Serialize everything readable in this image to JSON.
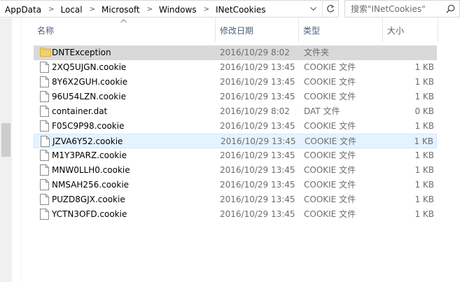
{
  "address_bar": {
    "crumbs": [
      "AppData",
      "Local",
      "Microsoft",
      "Windows",
      "INetCookies"
    ],
    "separator": ">"
  },
  "search": {
    "placeholder": "搜索\"INetCookies\""
  },
  "columns": {
    "name": "名称",
    "date": "修改日期",
    "type": "类型",
    "size": "大小"
  },
  "files": [
    {
      "name": "DNTException",
      "date": "2016/10/29 8:02",
      "type": "文件夹",
      "size": "",
      "icon": "folder-icon",
      "state": "selected"
    },
    {
      "name": "2XQ5UJGN.cookie",
      "date": "2016/10/29 13:45",
      "type": "COOKIE 文件",
      "size": "1 KB",
      "icon": "file-icon",
      "state": ""
    },
    {
      "name": "8Y6X2GUH.cookie",
      "date": "2016/10/29 13:45",
      "type": "COOKIE 文件",
      "size": "1 KB",
      "icon": "file-icon",
      "state": ""
    },
    {
      "name": "96U54LZN.cookie",
      "date": "2016/10/29 13:45",
      "type": "COOKIE 文件",
      "size": "1 KB",
      "icon": "file-icon",
      "state": ""
    },
    {
      "name": "container.dat",
      "date": "2016/10/29 8:02",
      "type": "DAT 文件",
      "size": "0 KB",
      "icon": "file-icon",
      "state": ""
    },
    {
      "name": "F05C9P98.cookie",
      "date": "2016/10/29 13:45",
      "type": "COOKIE 文件",
      "size": "1 KB",
      "icon": "file-icon",
      "state": ""
    },
    {
      "name": "JZVA6Y52.cookie",
      "date": "2016/10/29 13:45",
      "type": "COOKIE 文件",
      "size": "1 KB",
      "icon": "file-icon",
      "state": "hover"
    },
    {
      "name": "M1Y3PARZ.cookie",
      "date": "2016/10/29 13:45",
      "type": "COOKIE 文件",
      "size": "1 KB",
      "icon": "file-icon",
      "state": ""
    },
    {
      "name": "MNW0LLH0.cookie",
      "date": "2016/10/29 13:45",
      "type": "COOKIE 文件",
      "size": "1 KB",
      "icon": "file-icon",
      "state": ""
    },
    {
      "name": "NMSAH256.cookie",
      "date": "2016/10/29 13:45",
      "type": "COOKIE 文件",
      "size": "1 KB",
      "icon": "file-icon",
      "state": ""
    },
    {
      "name": "PUZD8GJX.cookie",
      "date": "2016/10/29 13:45",
      "type": "COOKIE 文件",
      "size": "1 KB",
      "icon": "file-icon",
      "state": ""
    },
    {
      "name": "YCTN3OFD.cookie",
      "date": "2016/10/29 13:45",
      "type": "COOKIE 文件",
      "size": "1 KB",
      "icon": "file-icon",
      "state": ""
    }
  ],
  "colors": {
    "selected_row": "#d9d9d9",
    "hover_row": "#e5f3ff",
    "header_text": "#4c607a",
    "folder": "#f4d06b"
  }
}
